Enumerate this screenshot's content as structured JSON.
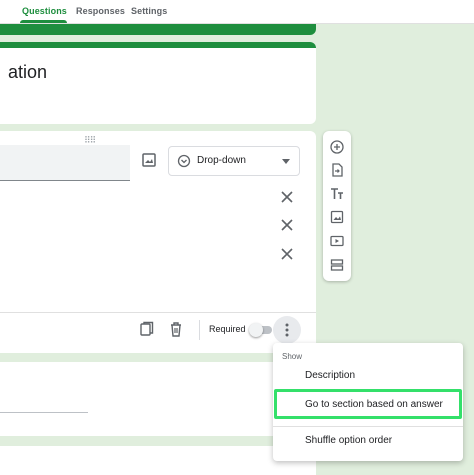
{
  "tabs": [
    {
      "label": "Questions",
      "active": true
    },
    {
      "label": "Responses",
      "active": false
    },
    {
      "label": "Settings",
      "active": false
    }
  ],
  "form": {
    "title_fragment": "ation"
  },
  "question": {
    "type_label": "Dropdown",
    "type_value": "Drop-down",
    "required_label": "Required",
    "required": false
  },
  "toolbar": {
    "icons": [
      "add-question-icon",
      "import-questions-icon",
      "add-title-icon",
      "add-image-icon",
      "add-video-icon",
      "add-section-icon"
    ]
  },
  "menu": {
    "header": "Show",
    "items": [
      {
        "label": "Description"
      },
      {
        "label": "Go to section based on answer",
        "highlighted": true
      },
      {
        "label": "Shuffle option order"
      }
    ]
  },
  "colors": {
    "accent": "#1e8e3e",
    "background": "#e0eedd",
    "highlight_border": "#34e06a"
  }
}
